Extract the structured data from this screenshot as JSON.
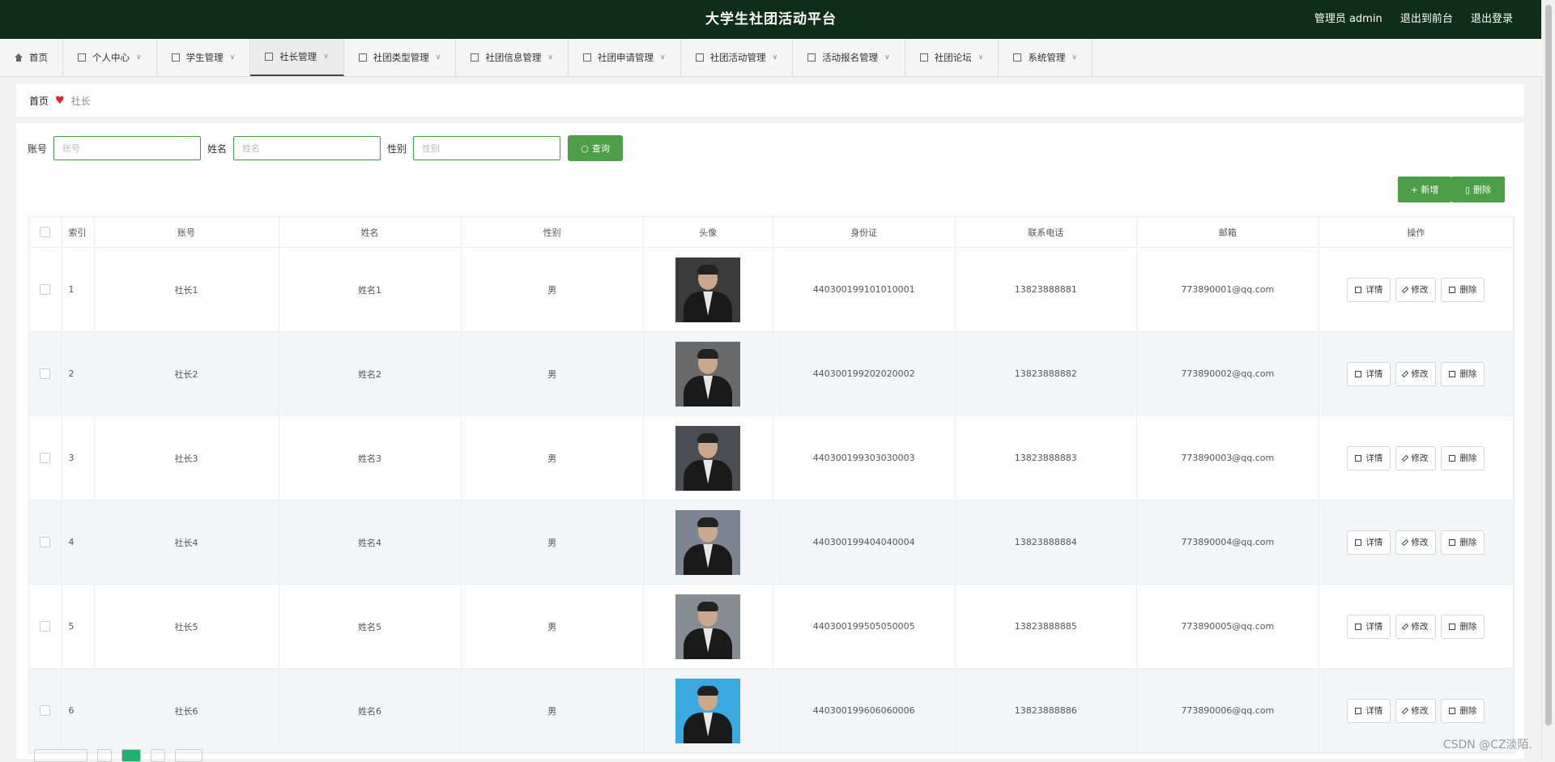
{
  "header": {
    "title": "大学生社团活动平台",
    "admin_label": "管理员 admin",
    "to_front": "退出到前台",
    "logout": "退出登录"
  },
  "nav": [
    {
      "label": "首页",
      "icon": "home-icon"
    },
    {
      "label": "个人中心",
      "icon": "user-icon"
    },
    {
      "label": "学生管理",
      "icon": "printer-icon"
    },
    {
      "label": "社长管理",
      "icon": "checkbox-icon"
    },
    {
      "label": "社团类型管理",
      "icon": "location-icon"
    },
    {
      "label": "社团信息管理",
      "icon": "bell-icon"
    },
    {
      "label": "社团申请管理",
      "icon": "document-icon"
    },
    {
      "label": "社团活动管理",
      "icon": "flag-icon"
    },
    {
      "label": "活动报名管理",
      "icon": "card-icon"
    },
    {
      "label": "社团论坛",
      "icon": "crop-icon"
    },
    {
      "label": "系统管理",
      "icon": "list-icon"
    }
  ],
  "breadcrumb": {
    "home": "首页",
    "current": "社长"
  },
  "search": {
    "account_label": "账号",
    "account_placeholder": "账号",
    "name_label": "姓名",
    "name_placeholder": "姓名",
    "gender_label": "性别",
    "gender_placeholder": "性别",
    "query_button": "查询"
  },
  "actions": {
    "add": "+ 新增",
    "delete": "删除"
  },
  "table": {
    "headers": [
      "索引",
      "账号",
      "姓名",
      "性别",
      "头像",
      "身份证",
      "联系电话",
      "邮箱",
      "操作"
    ],
    "op_detail": "详情",
    "op_edit": "修改",
    "op_delete": "删除",
    "rows": [
      {
        "index": "1",
        "account": "社长1",
        "name": "姓名1",
        "gender": "男",
        "id_card": "440300199101010001",
        "phone": "13823888881",
        "email": "773890001@qq.com"
      },
      {
        "index": "2",
        "account": "社长2",
        "name": "姓名2",
        "gender": "男",
        "id_card": "440300199202020002",
        "phone": "13823888882",
        "email": "773890002@qq.com"
      },
      {
        "index": "3",
        "account": "社长3",
        "name": "姓名3",
        "gender": "男",
        "id_card": "440300199303030003",
        "phone": "13823888883",
        "email": "773890003@qq.com"
      },
      {
        "index": "4",
        "account": "社长4",
        "name": "姓名4",
        "gender": "男",
        "id_card": "440300199404040004",
        "phone": "13823888884",
        "email": "773890004@qq.com"
      },
      {
        "index": "5",
        "account": "社长5",
        "name": "姓名5",
        "gender": "男",
        "id_card": "440300199505050005",
        "phone": "13823888885",
        "email": "773890005@qq.com"
      },
      {
        "index": "6",
        "account": "社长6",
        "name": "姓名6",
        "gender": "男",
        "id_card": "440300199606060006",
        "phone": "13823888886",
        "email": "773890006@qq.com"
      }
    ]
  },
  "watermark": "CSDN @CZ淡陌."
}
